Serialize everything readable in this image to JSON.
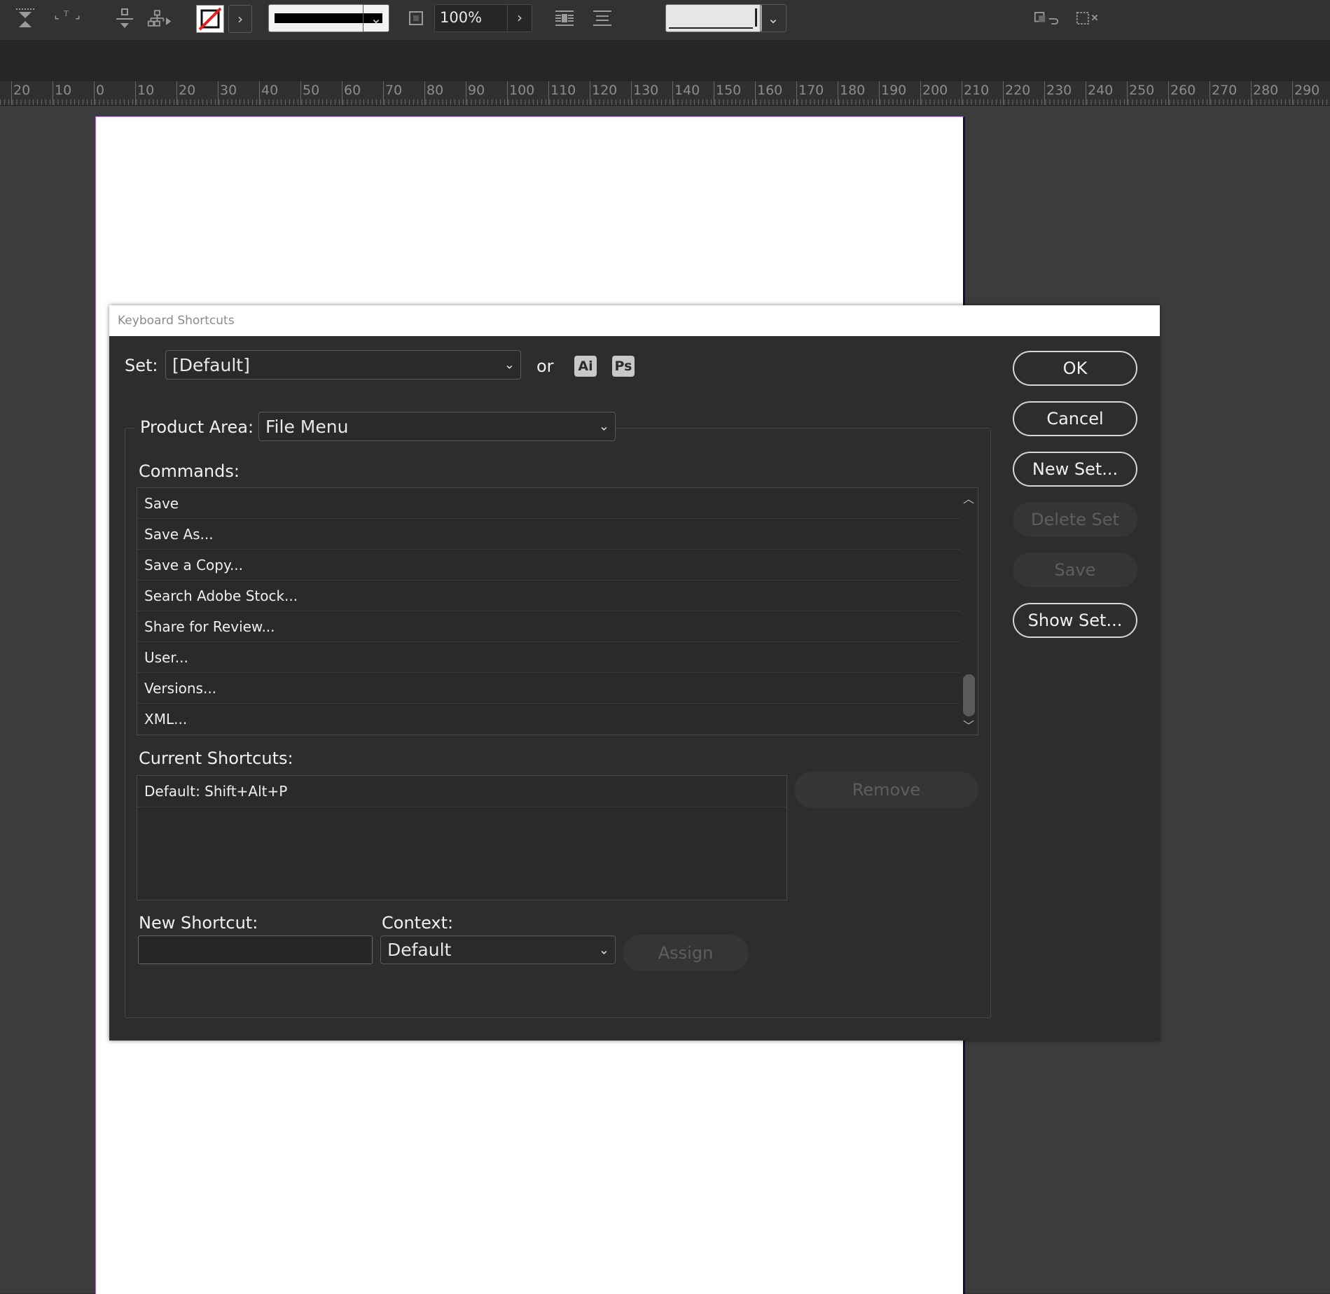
{
  "ruler": {
    "labels": [
      "20",
      "10",
      "0",
      "10",
      "20",
      "30",
      "40",
      "50",
      "60",
      "70",
      "80",
      "90",
      "100",
      "110",
      "120",
      "130",
      "140",
      "150",
      "160",
      "170",
      "180",
      "190",
      "200",
      "210",
      "220",
      "230",
      "240",
      "250",
      "260",
      "270",
      "280",
      "290"
    ]
  },
  "toolbar": {
    "zoom_value": "100%"
  },
  "dialog": {
    "title": "Keyboard Shortcuts",
    "set_label": "Set:",
    "set_value": "[Default]",
    "or_label": "or",
    "badge_ai": "Ai",
    "badge_ps": "Ps",
    "product_area_label": "Product Area:",
    "product_area_value": "File Menu",
    "commands_label": "Commands:",
    "commands": [
      "Save",
      "Save As...",
      "Save a Copy...",
      "Search Adobe Stock...",
      "Share for Review...",
      "User...",
      "Versions...",
      "XML..."
    ],
    "current_shortcuts_label": "Current Shortcuts:",
    "current_shortcuts": [
      "Default: Shift+Alt+P"
    ],
    "remove_label": "Remove",
    "new_shortcut_label": "New Shortcut:",
    "new_shortcut_value": "",
    "context_label": "Context:",
    "context_value": "Default",
    "assign_label": "Assign",
    "buttons": {
      "ok": "OK",
      "cancel": "Cancel",
      "new_set": "New Set...",
      "delete_set": "Delete Set",
      "save": "Save",
      "show_set": "Show Set..."
    }
  },
  "colors": {
    "ui_background": "#323232",
    "dialog_background": "#2d2d2d",
    "page_margin_guide": "#b06be0"
  }
}
